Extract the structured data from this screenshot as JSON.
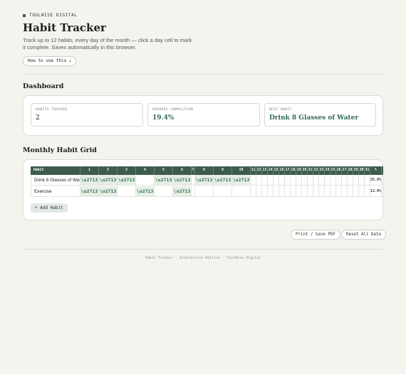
{
  "brand": {
    "name": "TOOLWISE DIGITAL"
  },
  "header": {
    "title": "Habit Tracker",
    "subtitle": "Track up to 12 habits, every day of the month — click a day cell to mark it complete. Saves automatically in this browser.",
    "howto_label": "How to use this ↓"
  },
  "dashboard": {
    "title": "Dashboard",
    "stats": [
      {
        "label": "HABITS TRACKED",
        "value": "2"
      },
      {
        "label": "AVERAGE COMPLETION",
        "value": "19.4%"
      },
      {
        "label": "BEST HABIT",
        "value": "Drink 8 Glasses of Water"
      }
    ]
  },
  "grid": {
    "title": "Monthly Habit Grid",
    "columns": {
      "habit": "Habit",
      "days": [
        "1",
        "2",
        "3",
        "4",
        "5",
        "6",
        "7",
        "8",
        "9",
        "10",
        "11",
        "12",
        "13",
        "14",
        "15",
        "16",
        "17",
        "18",
        "19",
        "20",
        "21",
        "22",
        "23",
        "24",
        "25",
        "26",
        "27",
        "28",
        "29",
        "30",
        "31"
      ],
      "percent": "%"
    },
    "check_symbol": "\\u2713",
    "rows": [
      {
        "name": "Drink 8 Glasses of Water",
        "display_name": "Drink 8 Glasses of Wat",
        "checked": [
          1,
          2,
          3,
          5,
          6,
          8,
          9,
          10
        ],
        "percent": "25.8%"
      },
      {
        "name": "Exercise",
        "display_name": "Exercise",
        "checked": [
          1,
          2,
          4,
          6
        ],
        "percent": "12.9%"
      }
    ],
    "add_label": "+ Add Habit"
  },
  "actions": {
    "print_label": "Print / Save PDF",
    "reset_label": "Reset All Data"
  },
  "footer": {
    "text": "Habit Tracker · Interactive Edition · ToolWise Digital"
  },
  "colors": {
    "accent": "#3d5c4d",
    "accent_text": "#2f6b4f",
    "checked_bg": "#e6efe6",
    "page_bg": "#f4f3ee"
  }
}
